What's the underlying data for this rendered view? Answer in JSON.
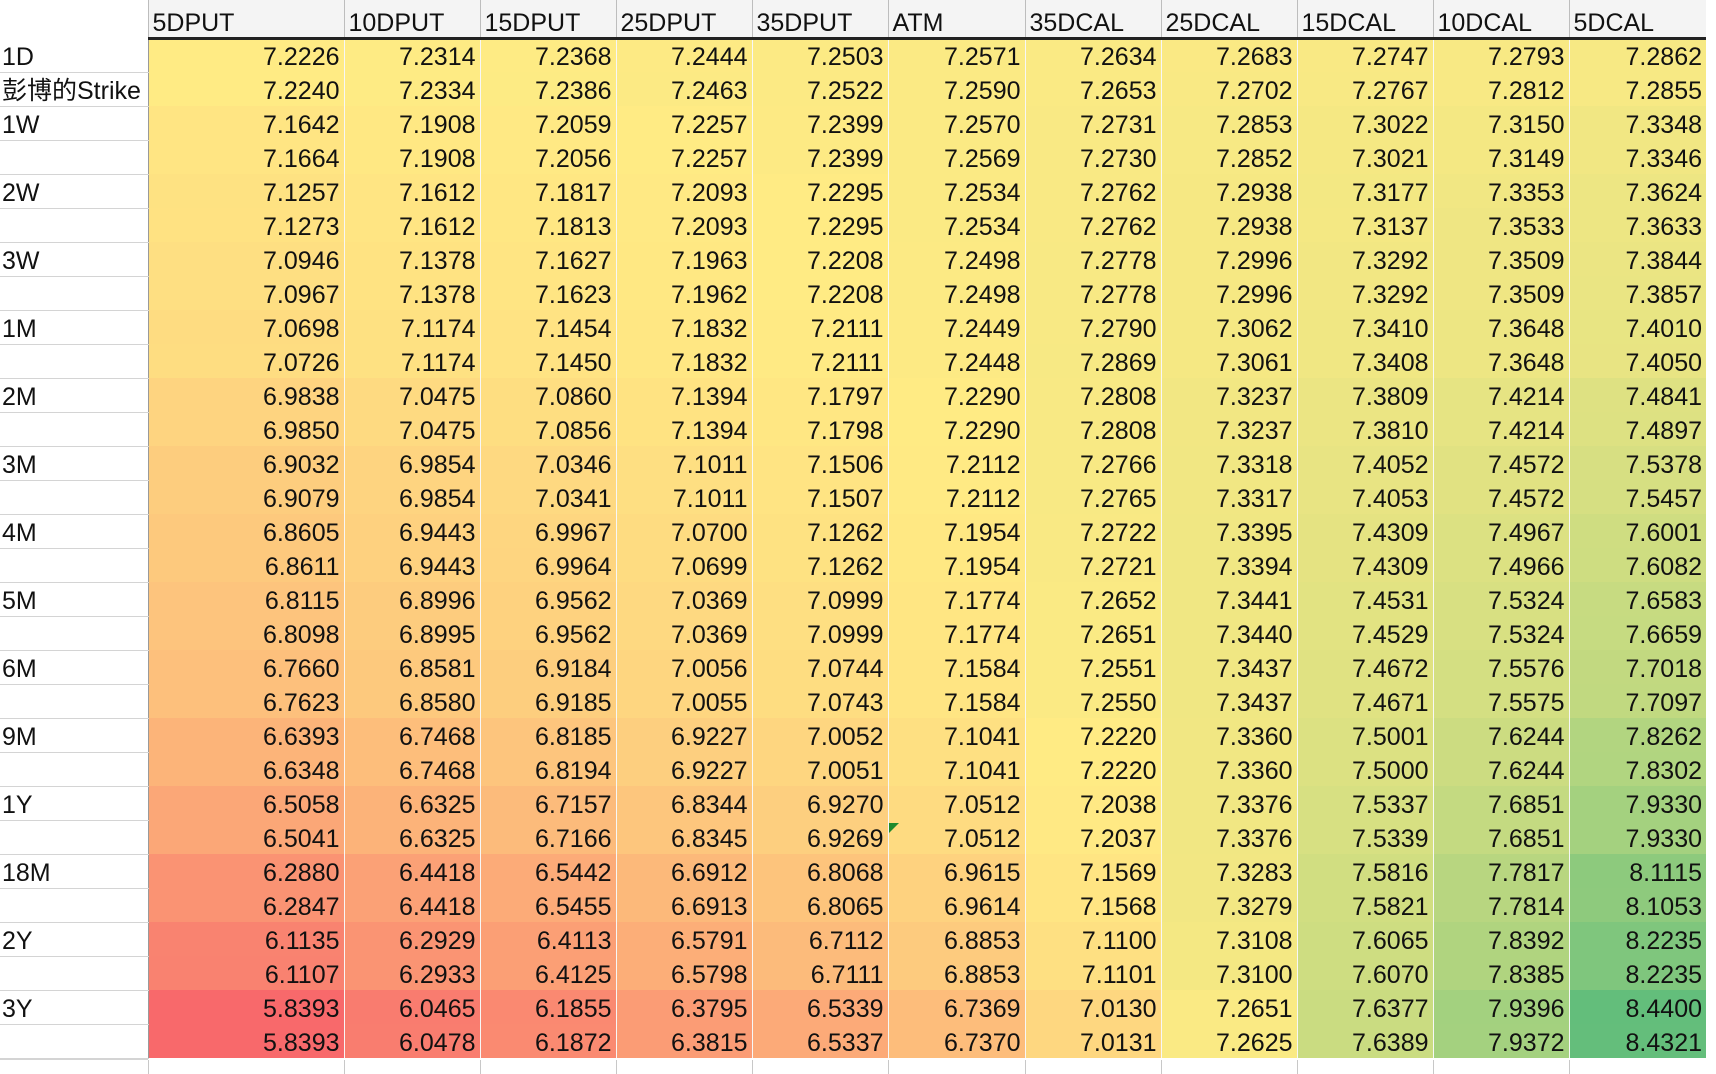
{
  "sheet": {
    "columns": [
      "5DPUT",
      "10DPUT",
      "15DPUT",
      "25DPUT",
      "35DPUT",
      "ATM",
      "35DCAL",
      "25DCAL",
      "15DCAL",
      "10DCAL",
      "5DCAL"
    ],
    "rows": [
      {
        "label": "1D",
        "values": [
          "7.2226",
          "7.2314",
          "7.2368",
          "7.2444",
          "7.2503",
          "7.2571",
          "7.2634",
          "7.2683",
          "7.2747",
          "7.2793",
          "7.2862"
        ]
      },
      {
        "label": "彭博的Strike",
        "values": [
          "7.2240",
          "7.2334",
          "7.2386",
          "7.2463",
          "7.2522",
          "7.2590",
          "7.2653",
          "7.2702",
          "7.2767",
          "7.2812",
          "7.2855"
        ]
      },
      {
        "label": "1W",
        "values": [
          "7.1642",
          "7.1908",
          "7.2059",
          "7.2257",
          "7.2399",
          "7.2570",
          "7.2731",
          "7.2853",
          "7.3022",
          "7.3150",
          "7.3348"
        ]
      },
      {
        "label": "",
        "values": [
          "7.1664",
          "7.1908",
          "7.2056",
          "7.2257",
          "7.2399",
          "7.2569",
          "7.2730",
          "7.2852",
          "7.3021",
          "7.3149",
          "7.3346"
        ]
      },
      {
        "label": "2W",
        "values": [
          "7.1257",
          "7.1612",
          "7.1817",
          "7.2093",
          "7.2295",
          "7.2534",
          "7.2762",
          "7.2938",
          "7.3177",
          "7.3353",
          "7.3624"
        ]
      },
      {
        "label": "",
        "values": [
          "7.1273",
          "7.1612",
          "7.1813",
          "7.2093",
          "7.2295",
          "7.2534",
          "7.2762",
          "7.2938",
          "7.3137",
          "7.3533",
          "7.3633"
        ]
      },
      {
        "label": "3W",
        "values": [
          "7.0946",
          "7.1378",
          "7.1627",
          "7.1963",
          "7.2208",
          "7.2498",
          "7.2778",
          "7.2996",
          "7.3292",
          "7.3509",
          "7.3844"
        ]
      },
      {
        "label": "",
        "values": [
          "7.0967",
          "7.1378",
          "7.1623",
          "7.1962",
          "7.2208",
          "7.2498",
          "7.2778",
          "7.2996",
          "7.3292",
          "7.3509",
          "7.3857"
        ]
      },
      {
        "label": "1M",
        "values": [
          "7.0698",
          "7.1174",
          "7.1454",
          "7.1832",
          "7.2111",
          "7.2449",
          "7.2790",
          "7.3062",
          "7.3410",
          "7.3648",
          "7.4010"
        ]
      },
      {
        "label": "",
        "values": [
          "7.0726",
          "7.1174",
          "7.1450",
          "7.1832",
          "7.2111",
          "7.2448",
          "7.2869",
          "7.3061",
          "7.3408",
          "7.3648",
          "7.4050"
        ]
      },
      {
        "label": "2M",
        "values": [
          "6.9838",
          "7.0475",
          "7.0860",
          "7.1394",
          "7.1797",
          "7.2290",
          "7.2808",
          "7.3237",
          "7.3809",
          "7.4214",
          "7.4841"
        ]
      },
      {
        "label": "",
        "values": [
          "6.9850",
          "7.0475",
          "7.0856",
          "7.1394",
          "7.1798",
          "7.2290",
          "7.2808",
          "7.3237",
          "7.3810",
          "7.4214",
          "7.4897"
        ]
      },
      {
        "label": "3M",
        "values": [
          "6.9032",
          "6.9854",
          "7.0346",
          "7.1011",
          "7.1506",
          "7.2112",
          "7.2766",
          "7.3318",
          "7.4052",
          "7.4572",
          "7.5378"
        ]
      },
      {
        "label": "",
        "values": [
          "6.9079",
          "6.9854",
          "7.0341",
          "7.1011",
          "7.1507",
          "7.2112",
          "7.2765",
          "7.3317",
          "7.4053",
          "7.4572",
          "7.5457"
        ]
      },
      {
        "label": "4M",
        "values": [
          "6.8605",
          "6.9443",
          "6.9967",
          "7.0700",
          "7.1262",
          "7.1954",
          "7.2722",
          "7.3395",
          "7.4309",
          "7.4967",
          "7.6001"
        ]
      },
      {
        "label": "",
        "values": [
          "6.8611",
          "6.9443",
          "6.9964",
          "7.0699",
          "7.1262",
          "7.1954",
          "7.2721",
          "7.3394",
          "7.4309",
          "7.4966",
          "7.6082"
        ]
      },
      {
        "label": "5M",
        "values": [
          "6.8115",
          "6.8996",
          "6.9562",
          "7.0369",
          "7.0999",
          "7.1774",
          "7.2652",
          "7.3441",
          "7.4531",
          "7.5324",
          "7.6583"
        ]
      },
      {
        "label": "",
        "values": [
          "6.8098",
          "6.8995",
          "6.9562",
          "7.0369",
          "7.0999",
          "7.1774",
          "7.2651",
          "7.3440",
          "7.4529",
          "7.5324",
          "7.6659"
        ]
      },
      {
        "label": "6M",
        "values": [
          "6.7660",
          "6.8581",
          "6.9184",
          "7.0056",
          "7.0744",
          "7.1584",
          "7.2551",
          "7.3437",
          "7.4672",
          "7.5576",
          "7.7018"
        ]
      },
      {
        "label": "",
        "values": [
          "6.7623",
          "6.8580",
          "6.9185",
          "7.0055",
          "7.0743",
          "7.1584",
          "7.2550",
          "7.3437",
          "7.4671",
          "7.5575",
          "7.7097"
        ]
      },
      {
        "label": "9M",
        "values": [
          "6.6393",
          "6.7468",
          "6.8185",
          "6.9227",
          "7.0052",
          "7.1041",
          "7.2220",
          "7.3360",
          "7.5001",
          "7.6244",
          "7.8262"
        ]
      },
      {
        "label": "",
        "values": [
          "6.6348",
          "6.7468",
          "6.8194",
          "6.9227",
          "7.0051",
          "7.1041",
          "7.2220",
          "7.3360",
          "7.5000",
          "7.6244",
          "7.8302"
        ]
      },
      {
        "label": "1Y",
        "values": [
          "6.5058",
          "6.6325",
          "6.7157",
          "6.8344",
          "6.9270",
          "7.0512",
          "7.2038",
          "7.3376",
          "7.5337",
          "7.6851",
          "7.9330"
        ]
      },
      {
        "label": "",
        "values": [
          "6.5041",
          "6.6325",
          "6.7166",
          "6.8345",
          "6.9269",
          "7.0512",
          "7.2037",
          "7.3376",
          "7.5339",
          "7.6851",
          "7.9330"
        ]
      },
      {
        "label": "18M",
        "values": [
          "6.2880",
          "6.4418",
          "6.5442",
          "6.6912",
          "6.8068",
          "6.9615",
          "7.1569",
          "7.3283",
          "7.5816",
          "7.7817",
          "8.1115"
        ]
      },
      {
        "label": "",
        "values": [
          "6.2847",
          "6.4418",
          "6.5455",
          "6.6913",
          "6.8065",
          "6.9614",
          "7.1568",
          "7.3279",
          "7.5821",
          "7.7814",
          "8.1053"
        ]
      },
      {
        "label": "2Y",
        "values": [
          "6.1135",
          "6.2929",
          "6.4113",
          "6.5791",
          "6.7112",
          "6.8853",
          "7.1100",
          "7.3108",
          "7.6065",
          "7.8392",
          "8.2235"
        ]
      },
      {
        "label": "",
        "values": [
          "6.1107",
          "6.2933",
          "6.4125",
          "6.5798",
          "6.7111",
          "6.8853",
          "7.1101",
          "7.3100",
          "7.6070",
          "7.8385",
          "8.2235"
        ]
      },
      {
        "label": "3Y",
        "values": [
          "5.8393",
          "6.0465",
          "6.1855",
          "6.3795",
          "6.5339",
          "6.7369",
          "7.0130",
          "7.2651",
          "7.6377",
          "7.9396",
          "8.4400"
        ]
      },
      {
        "label": "",
        "values": [
          "5.8393",
          "6.0478",
          "6.1872",
          "6.3815",
          "6.5337",
          "6.7370",
          "7.0131",
          "7.2625",
          "7.6389",
          "7.9372",
          "8.4321"
        ]
      }
    ],
    "color_scale": {
      "low": "#f8696b",
      "mid": "#ffeb84",
      "high": "#63be7b"
    },
    "comment_marker_color": "#1e8a2e"
  }
}
